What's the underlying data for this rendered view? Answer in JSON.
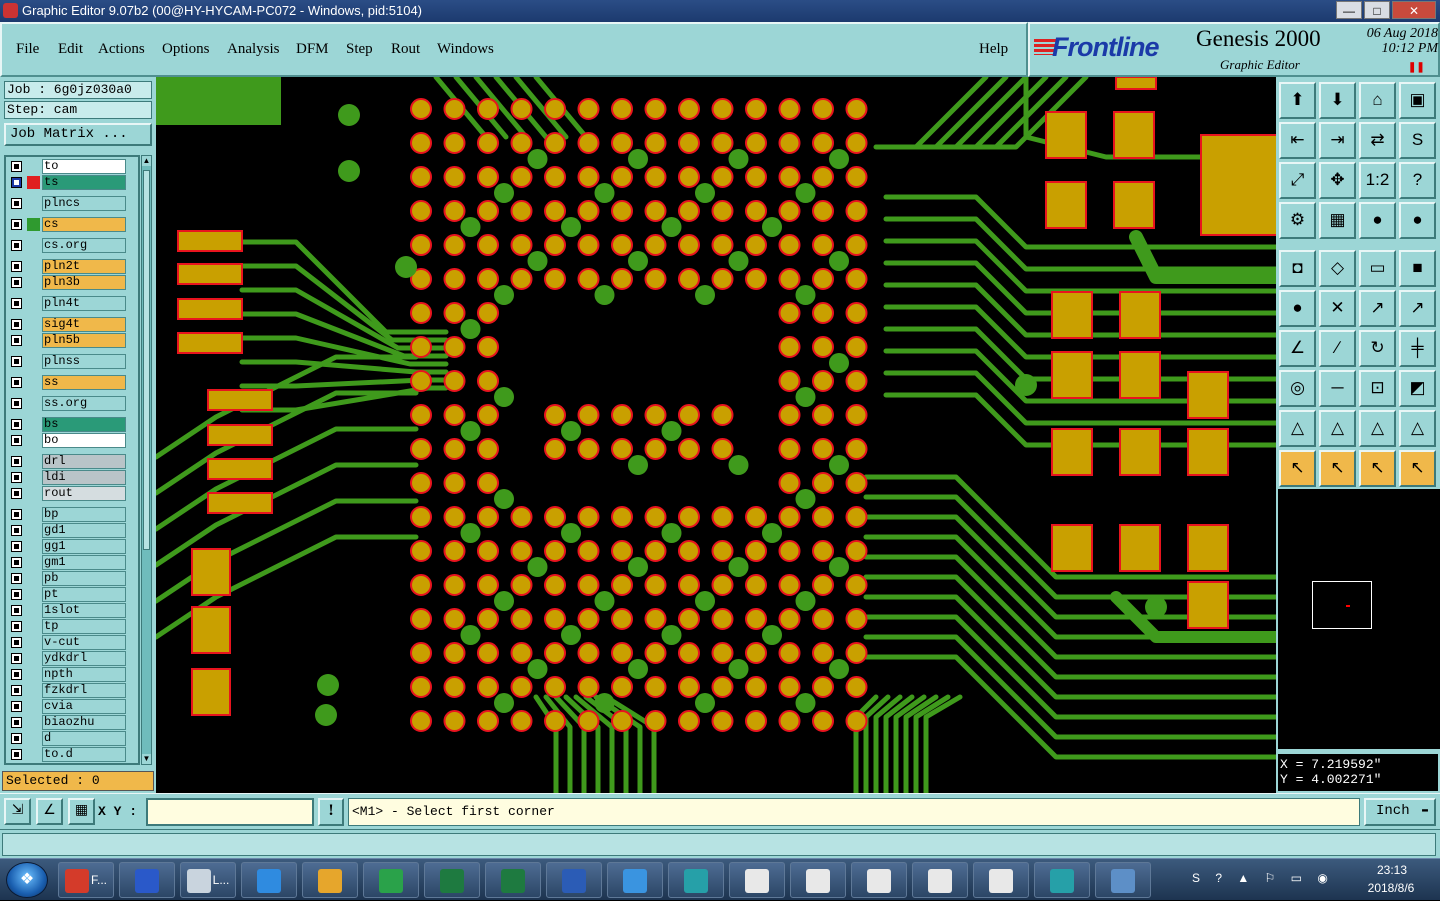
{
  "window": {
    "title": "Graphic Editor 9.07b2 (00@HY-HYCAM-PC072 - Windows, pid:5104)"
  },
  "menu": [
    "File",
    "Edit",
    "Actions",
    "Options",
    "Analysis",
    "DFM",
    "Step",
    "Rout",
    "Windows"
  ],
  "help": "Help",
  "brand": {
    "logo": "Frontline",
    "product": "Genesis 2000",
    "subtitle": "Graphic Editor",
    "date": "06 Aug 2018",
    "time": "10:12 PM"
  },
  "job": {
    "job_label": "Job : 6g0jz030a0",
    "step_label": "Step: cam",
    "matrix_button": "Job Matrix ..."
  },
  "layers": [
    {
      "name": "to",
      "fill": "#ffffff",
      "swatch": "",
      "sel": false
    },
    {
      "name": "ts",
      "fill": "#2a9a78",
      "swatch": "#e02020",
      "sel": true
    },
    {
      "name": "plncs",
      "fill": "#9cd6d6",
      "swatch": "",
      "sel": false
    },
    {
      "name": "cs",
      "fill": "#f0b84a",
      "swatch": "#2f9a2f",
      "sel": false
    },
    {
      "name": "cs.org",
      "fill": "#9cd6d6",
      "swatch": "",
      "sel": false
    },
    {
      "name": "pln2t",
      "fill": "#f0b84a",
      "swatch": "",
      "sel": false
    },
    {
      "name": "pln3b",
      "fill": "#f0b84a",
      "swatch": "",
      "sel": false
    },
    {
      "name": "pln4t",
      "fill": "#9cd6d6",
      "swatch": "",
      "sel": false
    },
    {
      "name": "sig4t",
      "fill": "#f0b84a",
      "swatch": "",
      "sel": false
    },
    {
      "name": "pln5b",
      "fill": "#f0b84a",
      "swatch": "",
      "sel": false
    },
    {
      "name": "plnss",
      "fill": "#9cd6d6",
      "swatch": "",
      "sel": false
    },
    {
      "name": "ss",
      "fill": "#f0b84a",
      "swatch": "",
      "sel": false
    },
    {
      "name": "ss.org",
      "fill": "#9cd6d6",
      "swatch": "",
      "sel": false
    },
    {
      "name": "bs",
      "fill": "#2a9a78",
      "swatch": "",
      "sel": false
    },
    {
      "name": "bo",
      "fill": "#ffffff",
      "swatch": "",
      "sel": false
    },
    {
      "name": "drl",
      "fill": "#b9c4c8",
      "swatch": "",
      "sel": false
    },
    {
      "name": "ldi",
      "fill": "#b9c4c8",
      "swatch": "",
      "sel": false
    },
    {
      "name": "rout",
      "fill": "#d5dde0",
      "swatch": "",
      "sel": false
    },
    {
      "name": "bp",
      "fill": "#9cd6d6",
      "swatch": "",
      "sel": false
    },
    {
      "name": "gd1",
      "fill": "#9cd6d6",
      "swatch": "",
      "sel": false
    },
    {
      "name": "gg1",
      "fill": "#9cd6d6",
      "swatch": "",
      "sel": false
    },
    {
      "name": "gm1",
      "fill": "#9cd6d6",
      "swatch": "",
      "sel": false
    },
    {
      "name": "pb",
      "fill": "#9cd6d6",
      "swatch": "",
      "sel": false
    },
    {
      "name": "pt",
      "fill": "#9cd6d6",
      "swatch": "",
      "sel": false
    },
    {
      "name": "1slot",
      "fill": "#9cd6d6",
      "swatch": "",
      "sel": false
    },
    {
      "name": "tp",
      "fill": "#9cd6d6",
      "swatch": "",
      "sel": false
    },
    {
      "name": "v-cut",
      "fill": "#9cd6d6",
      "swatch": "",
      "sel": false
    },
    {
      "name": "ydkdrl",
      "fill": "#9cd6d6",
      "swatch": "",
      "sel": false
    },
    {
      "name": "npth",
      "fill": "#9cd6d6",
      "swatch": "",
      "sel": false
    },
    {
      "name": "fzkdrl",
      "fill": "#9cd6d6",
      "swatch": "",
      "sel": false
    },
    {
      "name": "cvia",
      "fill": "#9cd6d6",
      "swatch": "",
      "sel": false
    },
    {
      "name": "biaozhu",
      "fill": "#9cd6d6",
      "swatch": "",
      "sel": false
    },
    {
      "name": "d",
      "fill": "#9cd6d6",
      "swatch": "",
      "sel": false
    },
    {
      "name": "to.d",
      "fill": "#9cd6d6",
      "swatch": "",
      "sel": false
    }
  ],
  "selected": "Selected : 0",
  "coords": {
    "x": "X = 7.219592\"",
    "y": "Y = 4.002271\""
  },
  "cmd": {
    "xy_label": "X Y :",
    "input_value": "",
    "prompt": "<M1> - Select first corner",
    "unit": "Inch"
  },
  "colors": {
    "trace": "#3f9a1c",
    "pad": "#c9a000",
    "pad_outline": "#e8141e",
    "background": "#000000"
  },
  "tools": [
    "move-up-icon",
    "move-down-icon",
    "home-icon",
    "window-icon",
    "move-left-icon",
    "move-right-icon",
    "swap-icon",
    "s-curve-icon",
    "fit-icon",
    "zoom-icon",
    "one-to-two-icon",
    "help-icon",
    "snap-icon",
    "grid-icon",
    "layer-red-icon",
    "layer-red2-icon",
    "record-icon",
    "shape-icon",
    "ruler-icon",
    "dot-icon",
    "connect-icon",
    "cross-icon",
    "line-icon",
    "line2-icon",
    "angle-icon",
    "measure-icon",
    "rotate-icon",
    "align-icon",
    "node-icon",
    "dash-icon",
    "bracket-icon",
    "transform-icon",
    "tri-icon",
    "tri2-icon",
    "tri3-icon",
    "tri4-icon",
    "pointer-icon",
    "pointer2-icon",
    "pointer3-icon",
    "pointer4-icon"
  ],
  "taskbar": {
    "apps": [
      {
        "label": "F...",
        "icon": "genesis-icon",
        "color": "#d43b2a"
      },
      {
        "label": "",
        "icon": "save-icon",
        "color": "#2a59c9"
      },
      {
        "label": "L...",
        "icon": "scanner-icon",
        "color": "#c9d4de"
      },
      {
        "label": "",
        "icon": "ie-icon",
        "color": "#2f8be0"
      },
      {
        "label": "",
        "icon": "shell-icon",
        "color": "#e6a62c"
      },
      {
        "label": "",
        "icon": "frontline-f-icon",
        "color": "#2aa24a"
      },
      {
        "label": "",
        "icon": "excel-icon",
        "color": "#1e7a40"
      },
      {
        "label": "",
        "icon": "excel-icon",
        "color": "#1e7a40"
      },
      {
        "label": "",
        "icon": "word-icon",
        "color": "#2b5cb6"
      },
      {
        "label": "",
        "icon": "bird-icon",
        "color": "#3a94e0"
      },
      {
        "label": "",
        "icon": "eye-icon",
        "color": "#26a0a8"
      },
      {
        "label": "",
        "icon": "x-window-icon",
        "color": "#e8e8e8"
      },
      {
        "label": "",
        "icon": "x-window-icon",
        "color": "#e8e8e8"
      },
      {
        "label": "",
        "icon": "x-window-icon",
        "color": "#e8e8e8"
      },
      {
        "label": "",
        "icon": "x-window-icon",
        "color": "#e8e8e8"
      },
      {
        "label": "",
        "icon": "x-window-icon",
        "color": "#e8e8e8"
      },
      {
        "label": "",
        "icon": "eye-icon",
        "color": "#26a0a8"
      },
      {
        "label": "",
        "icon": "monitor-icon",
        "color": "#5d8fc7"
      }
    ]
  },
  "clock": {
    "time": "23:13",
    "date": "2018/8/6"
  }
}
